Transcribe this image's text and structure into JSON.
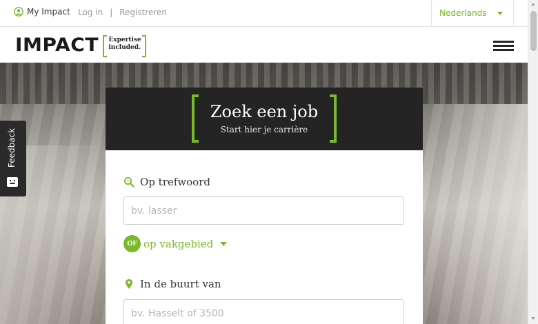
{
  "topbar": {
    "my_impact": "My Impact",
    "login": "Log in",
    "separator": "|",
    "register": "Registreren",
    "language": "Nederlands"
  },
  "header": {
    "logo_word": "IMPACT",
    "tagline_line1": "Expertise",
    "tagline_line2": "included."
  },
  "feedback": {
    "label": "Feedback"
  },
  "search": {
    "title": "Zoek een job",
    "subtitle": "Start hier je carrière",
    "keyword_label": "Op trefwoord",
    "keyword_placeholder": "bv. lasser",
    "or_badge": "OF",
    "field_link": "op vakgebied",
    "location_label": "In de buurt van",
    "location_placeholder": "bv. Hasselt of 3500"
  },
  "colors": {
    "accent": "#7ab929",
    "dark": "#242424"
  },
  "icons": [
    "user-circle-icon",
    "chevron-down-icon",
    "hamburger-menu-icon",
    "feedback-face-icon",
    "magnifier-icon",
    "location-pin-icon"
  ]
}
